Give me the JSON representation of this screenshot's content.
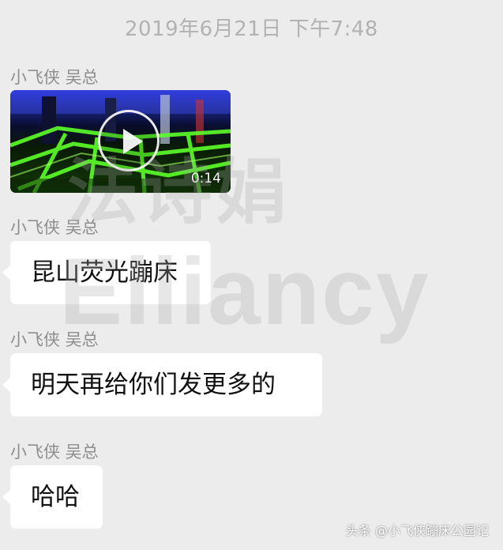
{
  "chat": {
    "timestamp": "2019年6月21日 下午7:48",
    "messages": [
      {
        "sender": "小飞侠 吴总",
        "type": "video",
        "duration": "0:14"
      },
      {
        "sender": "小飞侠 吴总",
        "type": "text",
        "text": "昆山荧光蹦床"
      },
      {
        "sender": "小飞侠 吴总",
        "type": "text",
        "text": "明天再给你们发更多的"
      },
      {
        "sender": "小飞侠 吴总",
        "type": "text",
        "text": "哈哈"
      }
    ]
  },
  "watermark": {
    "cn": "法诗娟",
    "en": "Elliancy"
  },
  "footer": {
    "credit": "头条 @小飞侠蹦床公园记"
  },
  "colors": {
    "background": "#ececec",
    "bubble": "#ffffff",
    "sender": "#8e8e8e",
    "timestamp": "#b2b2b2"
  },
  "icons": {
    "video_play": "play-icon"
  }
}
